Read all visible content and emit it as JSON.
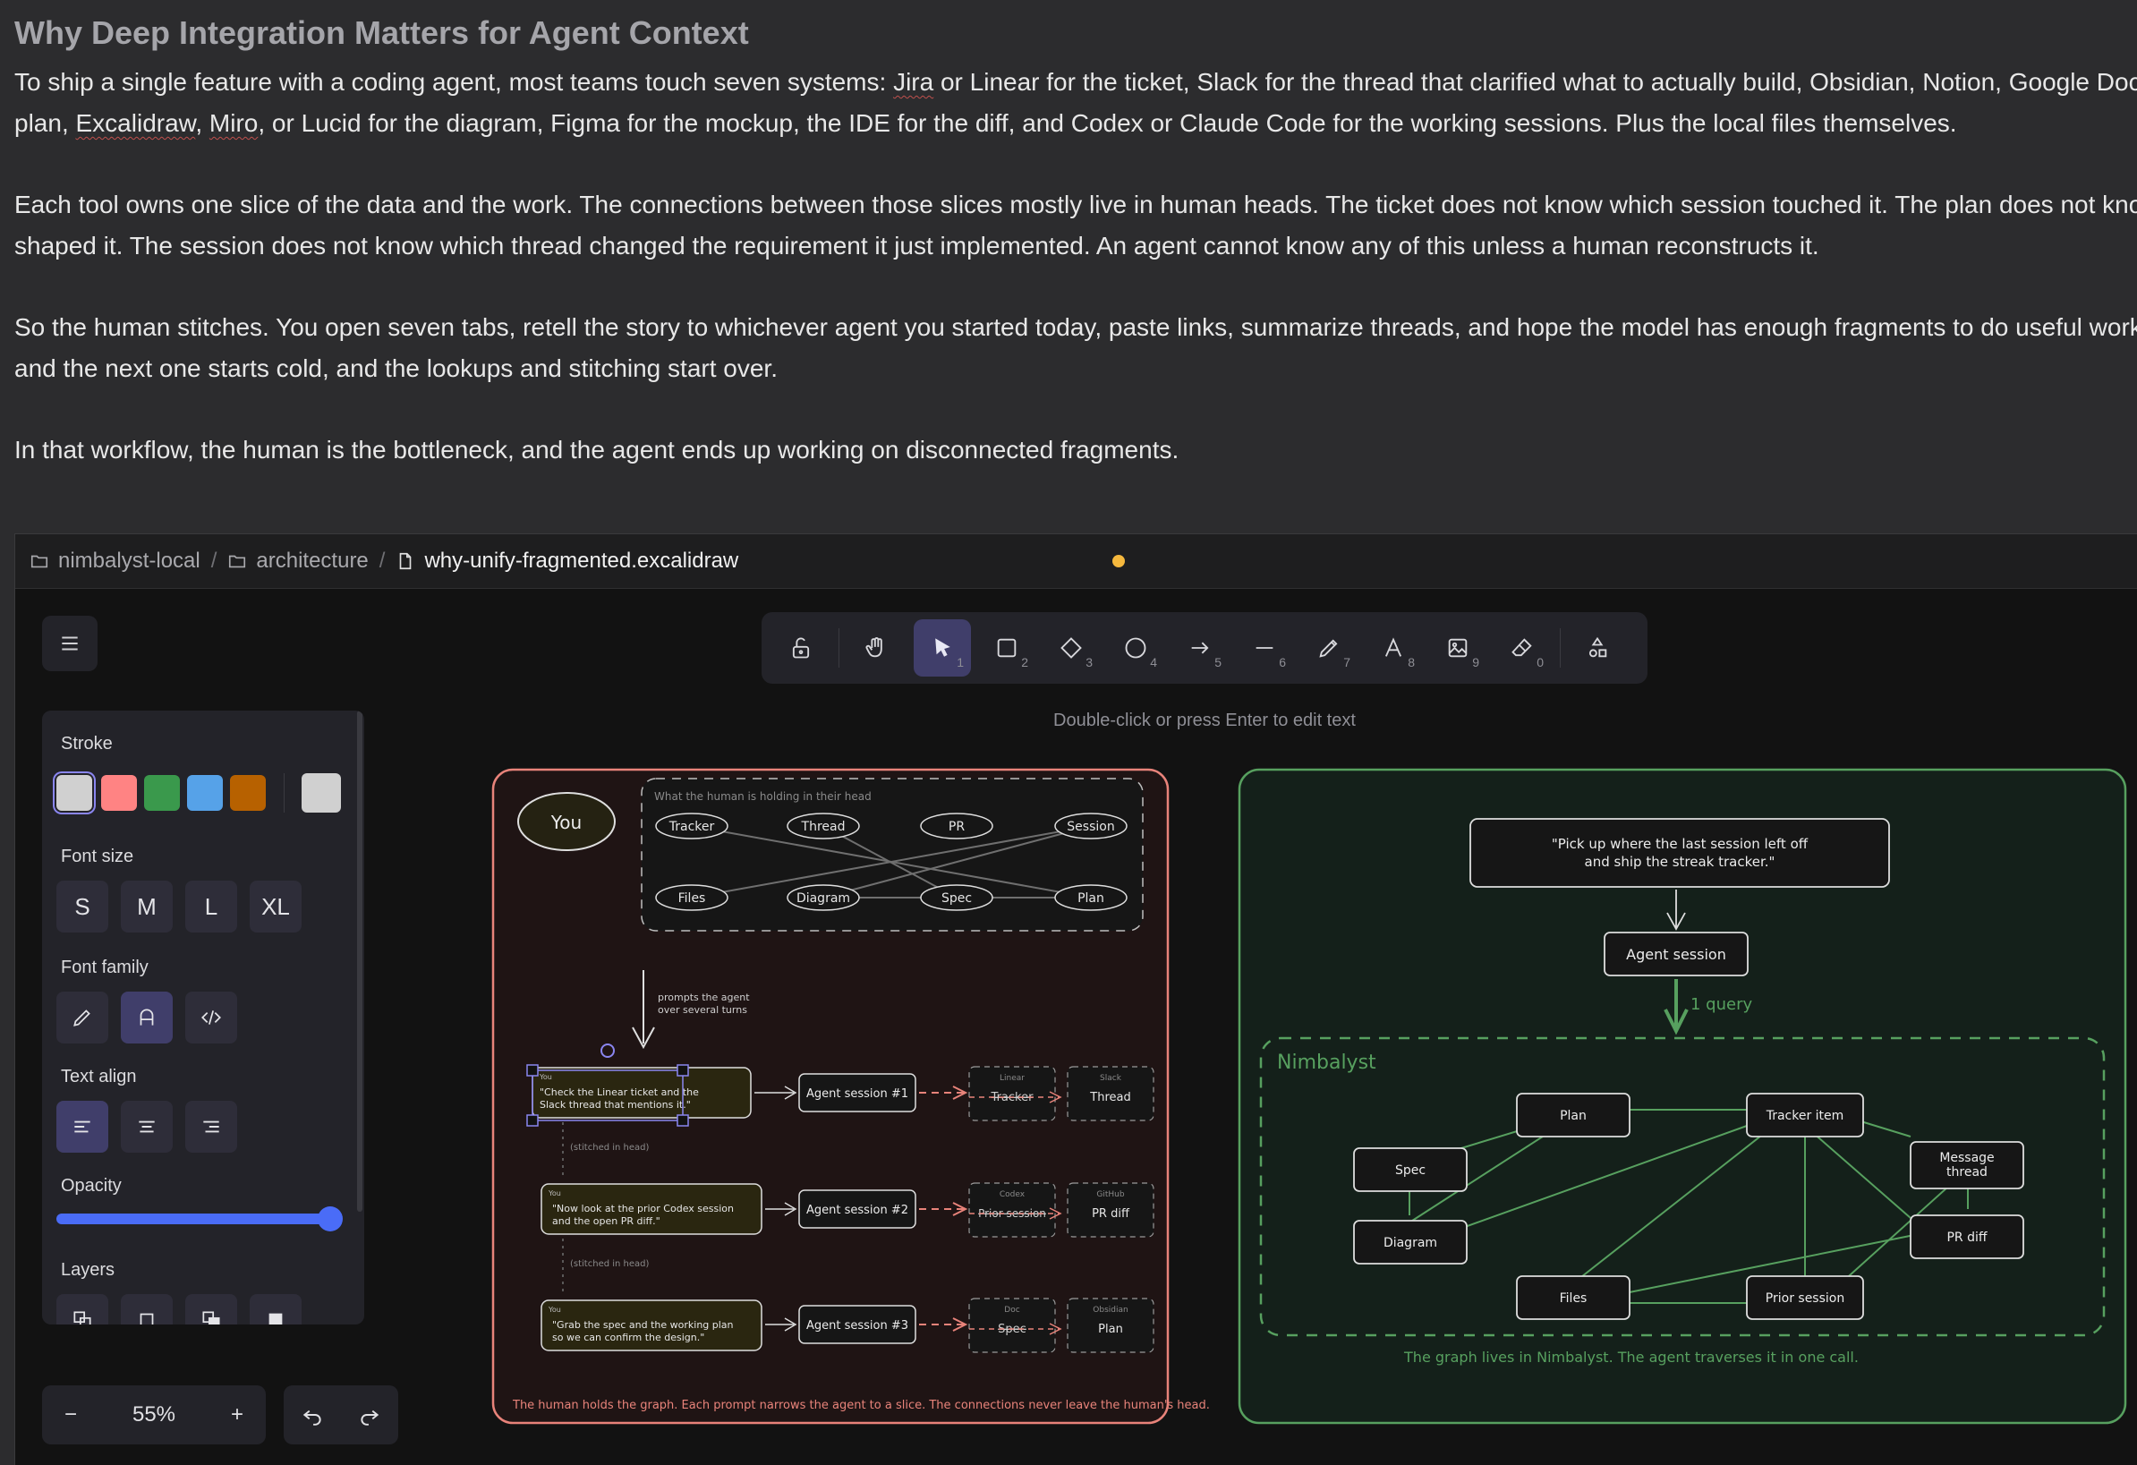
{
  "document": {
    "heading": "Why Deep Integration Matters for Agent Context",
    "p1_l1_a": "To ship a single feature with a coding agent, most teams touch seven systems: ",
    "p1_l1_jira": "Jira",
    "p1_l1_b": " or Linear for the ticket, Slack for the thread that clarified what to actually build, Obsidian, Notion, Google Docs",
    "p1_l2_a": "plan, ",
    "p1_l2_excalidraw": "Excalidraw",
    "p1_l2_b": ", ",
    "p1_l2_miro": "Miro",
    "p1_l2_c": ", or Lucid for the diagram, Figma for the mockup, the IDE for the diff, and Codex or Claude Code for the working sessions. Plus the local files themselves.",
    "p2_l1": "Each tool owns one slice of the data and the work. The connections between those slices mostly live in human heads. The ticket does not know which session touched it. The plan does not know",
    "p2_l2": "shaped it. The session does not know which thread changed the requirement it just implemented. An agent cannot know any of this unless a human reconstructs it.",
    "p3_l1": "So the human stitches. You open seven tabs, retell the story to whichever agent you started today, paste links, summarize threads, and hope the model has enough fragments to do useful work.",
    "p3_l2": "and the next one starts cold, and the lookups and stitching start over.",
    "p4": "In that workflow, the human is the bottleneck, and the agent ends up working on disconnected fragments."
  },
  "breadcrumb": {
    "workspace": "nimbalyst-local",
    "folder": "architecture",
    "file": "why-unify-fragmented.excalidraw"
  },
  "colors": {
    "unsaved_dot": "#f5b83d",
    "accent": "#403e6a",
    "slider": "#4a6cf7"
  },
  "toolbar": {
    "tools": [
      {
        "name": "lock",
        "key": ""
      },
      {
        "name": "hand",
        "key": ""
      },
      {
        "name": "selection",
        "key": "1"
      },
      {
        "name": "rectangle",
        "key": "2"
      },
      {
        "name": "diamond",
        "key": "3"
      },
      {
        "name": "ellipse",
        "key": "4"
      },
      {
        "name": "arrow",
        "key": "5"
      },
      {
        "name": "line",
        "key": "6"
      },
      {
        "name": "draw",
        "key": "7"
      },
      {
        "name": "text",
        "key": "8"
      },
      {
        "name": "image",
        "key": "9"
      },
      {
        "name": "eraser",
        "key": "0"
      },
      {
        "name": "more-tools",
        "key": ""
      }
    ],
    "hint": "Double-click or press Enter to edit text"
  },
  "properties": {
    "stroke_label": "Stroke",
    "stroke_colors": [
      "#d0d0d0",
      "#ff8383",
      "#3a994c",
      "#56a2e8",
      "#b76100"
    ],
    "stroke_current": "#d0d0d0",
    "font_size_label": "Font size",
    "font_sizes": [
      "S",
      "M",
      "L",
      "XL"
    ],
    "font_family_label": "Font family",
    "text_align_label": "Text align",
    "opacity_label": "Opacity",
    "opacity_value": 100,
    "layers_label": "Layers"
  },
  "zoom": {
    "minus": "−",
    "value": "55%",
    "plus": "+"
  },
  "diagram": {
    "left": {
      "you": "You",
      "head_title": "What the human is holding in their head",
      "head_row1": [
        "Tracker",
        "Thread",
        "PR",
        "Session"
      ],
      "head_row2": [
        "Files",
        "Diagram",
        "Spec",
        "Plan"
      ],
      "prompts_note_1": "prompts the agent",
      "prompts_note_2": "over several turns",
      "rows": [
        {
          "you": "You",
          "quote1": "\"Check the Linear ticket and the",
          "quote2": "Slack thread that mentions it.\"",
          "session": "Agent session #1",
          "t1": "Linear",
          "b1": "Tracker",
          "t2": "Slack",
          "b2": "Thread"
        },
        {
          "you": "You",
          "quote1": "\"Now look at the prior Codex session",
          "quote2": "and the open PR diff.\"",
          "session": "Agent session #2",
          "t1": "Codex",
          "b1": "Prior session",
          "t2": "GitHub",
          "b2": "PR diff"
        },
        {
          "you": "You",
          "quote1": "\"Grab the spec and the working plan",
          "quote2": "so we can confirm the design.\"",
          "session": "Agent session #3",
          "t1": "Doc",
          "b1": "Spec",
          "t2": "Obsidian",
          "b2": "Plan"
        }
      ],
      "stitched": "(stitched in head)",
      "caption": "The human holds the graph. Each prompt narrows the agent to a slice. The connections never leave the human's head."
    },
    "right": {
      "quote1": "\"Pick up where the last session left off",
      "quote2": "and ship the streak tracker.\"",
      "agent": "Agent session",
      "query": "1 query",
      "group": "Nimbalyst",
      "nodes": [
        "Plan",
        "Tracker item",
        "Spec",
        "Message",
        "thread",
        "Diagram",
        "PR diff",
        "Files",
        "Prior session"
      ],
      "caption": "The graph lives in Nimbalyst. The agent traverses it in one call."
    }
  }
}
